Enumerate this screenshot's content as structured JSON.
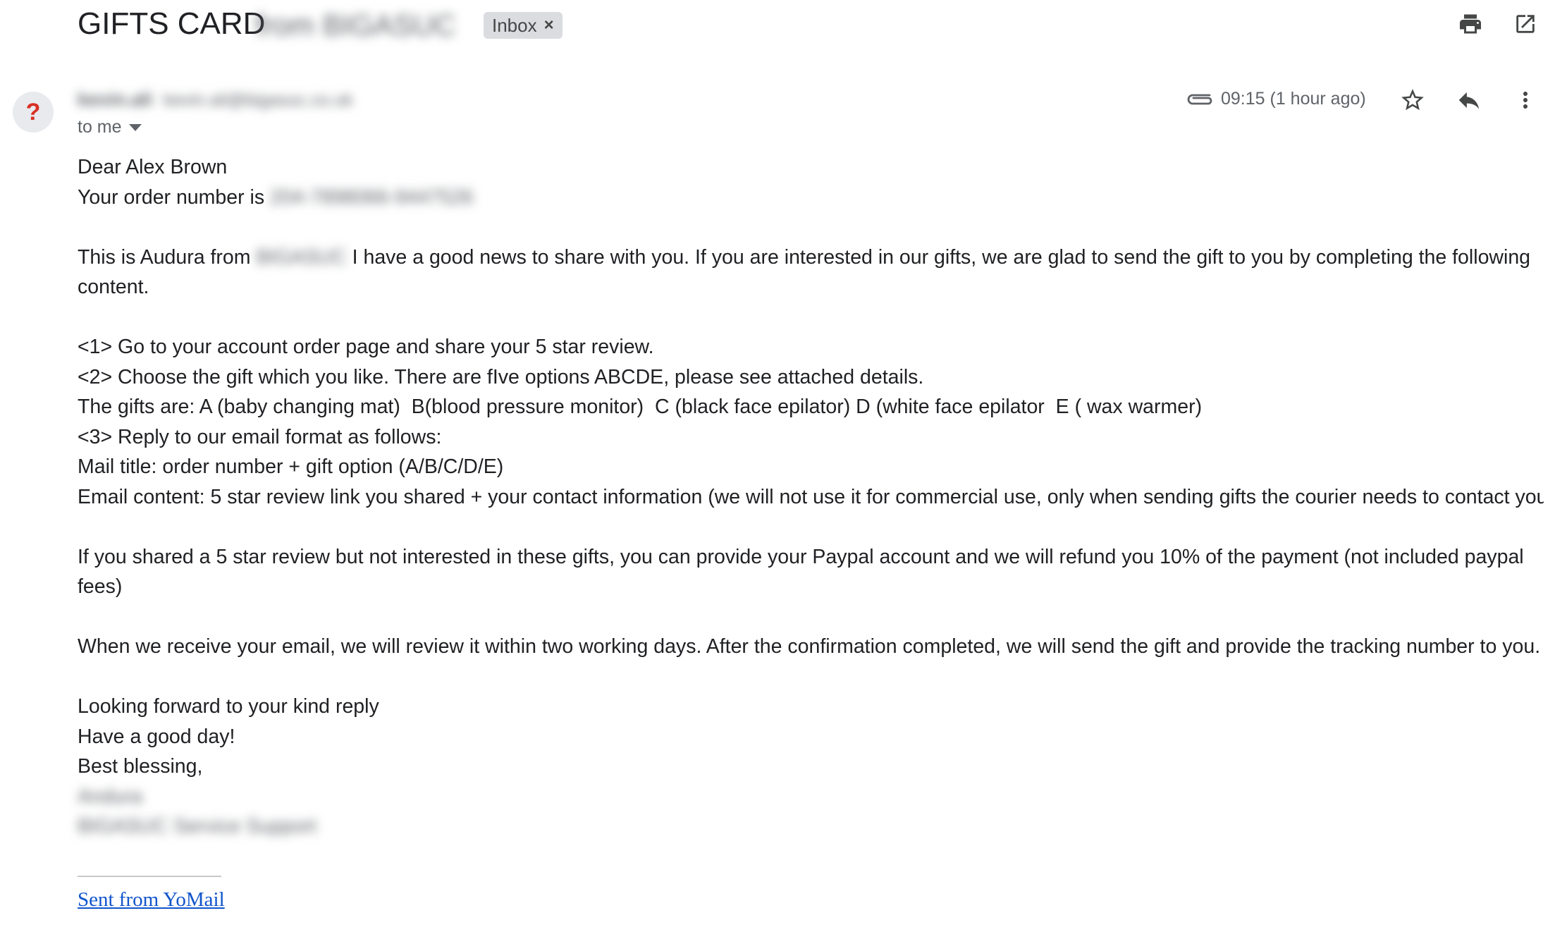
{
  "header": {
    "subject": "GIFTS CARD",
    "subject_blurred": "from BIGASUC",
    "label": "Inbox",
    "label_remove": "×"
  },
  "sender": {
    "avatar_glyph": "?",
    "name": "kevin.ali",
    "email": "kevin.ali@bigasuc.co.uk",
    "to_me": "to me",
    "time": "09:15 (1 hour ago)"
  },
  "icons": {
    "print": "print-icon",
    "open_new": "open-in-new-window-icon",
    "attachment": "attachment-icon",
    "star": "star-icon",
    "reply": "reply-icon",
    "more": "more-vertical-icon"
  },
  "body": {
    "greeting": "Dear Alex Brown",
    "order_prefix": "Your order number is",
    "order_number": "204-7898066-9447526",
    "intro_prefix": "This is Audura from",
    "intro_company": "BIGASUC",
    "intro_rest": " I have a good news to share with you. If you are interested in our gifts, we are glad to send the gift to you by completing the following content.",
    "step1": "<1> Go to your account order page and share your 5 star review.",
    "step2": "<2> Choose the gift which you like. There are fIve options ABCDE, please see attached details.",
    "gifts": "The gifts are: A (baby changing mat)  B(blood pressure monitor)  C (black face epilator) D (white face epilator  E ( wax warmer)",
    "step3": "<3> Reply to our email format as follows:",
    "mail_title": "Mail title: order number + gift option (A/B/C/D/E)",
    "email_content": "Email content: 5 star review link you shared + your contact information (we will not use it for commercial use, only when sending gifts the courier needs to contact you",
    "refund": "If you shared a 5 star review but not interested in these gifts, you can provide your Paypal account and we will refund you 10% of the payment (not included paypal fees)",
    "review": "When we receive your email, we will review it within two working days. After the confirmation completed, we will send the gift and provide the tracking number to you.",
    "closing1": "Looking forward to your kind reply",
    "closing2": "Have a good day!",
    "closing3": "Best blessing,",
    "signature_name": "Andura",
    "signature_team": "BIGASUC Service Support"
  },
  "footer": {
    "sent_from": "Sent from YoMail"
  }
}
